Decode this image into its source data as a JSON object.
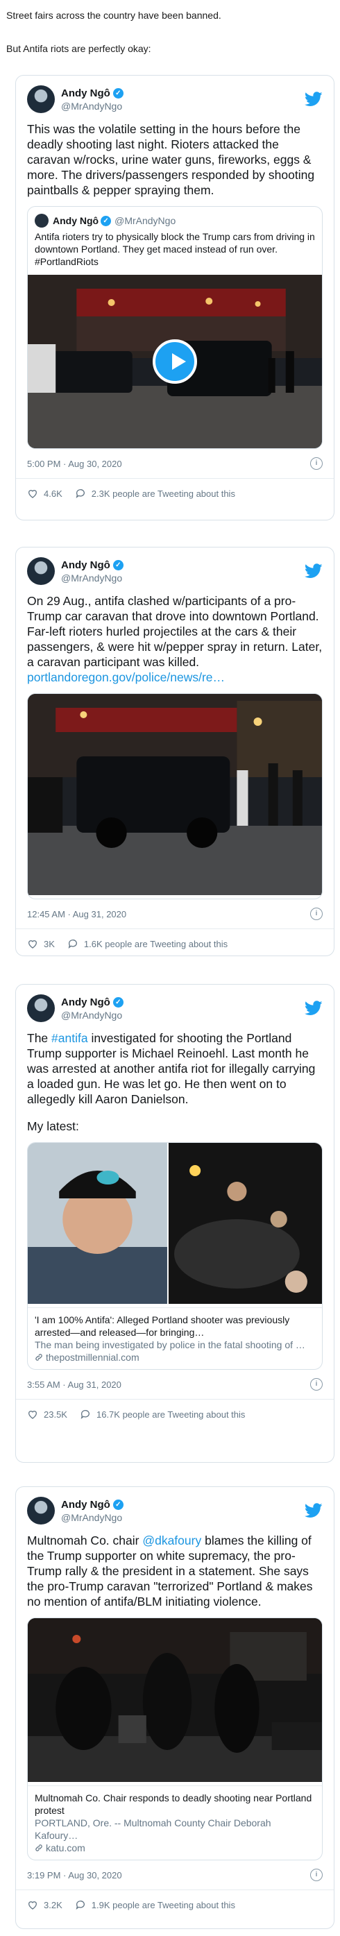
{
  "intro": {
    "line1": "Street fairs across the country have been banned.",
    "line2": "But Antifa riots are perfectly okay:"
  },
  "author": {
    "name": "Andy Ngô",
    "handle": "@MrAndyNgo"
  },
  "colors": {
    "link": "#1b95e0",
    "twitter_blue": "#1da1f2",
    "border": "#d8e1e8",
    "muted": "#657786"
  },
  "tweets": [
    {
      "text": "This was the volatile setting in the hours before the deadly shooting last night. Rioters attacked the caravan w/rocks, urine water guns, fireworks, eggs & more. The drivers/passengers responded by shooting paintballs & pepper spraying them.",
      "quote": {
        "name": "Andy Ngô",
        "handle": "@MrAndyNgo",
        "text": "Antifa rioters try to physically block the Trump cars from driving in downtown Portland. They get maced instead of run over. #PortlandRiots"
      },
      "timestamp": "5:00 PM · Aug 30, 2020",
      "likes": "4.6K",
      "tweeting": "2.3K people are Tweeting about this"
    },
    {
      "text": "On 29 Aug., antifa clashed w/participants of a pro-Trump car caravan that drove into downtown Portland. Far-left rioters hurled projectiles at the cars & their passengers, & were hit w/pepper spray in return. Later, a caravan participant was killed.",
      "link": "portlandoregon.gov/police/news/re…",
      "timestamp": "12:45 AM · Aug 31, 2020",
      "likes": "3K",
      "tweeting": "1.6K people are Tweeting about this"
    },
    {
      "text_pre": "The ",
      "hashtag": "#antifa",
      "text_post": " investigated for shooting the Portland Trump supporter is Michael Reinoehl. Last month he was arrested at another antifa riot for illegally carrying a loaded gun. He was let go. He then went on to allegedly kill Aaron Danielson.",
      "latest": "My latest:",
      "card": {
        "title": "'I am 100% Antifa': Alleged Portland shooter was previously arrested—and released—for bringing…",
        "desc": "The man being investigated by police in the fatal shooting of …",
        "domain": "thepostmillennial.com"
      },
      "timestamp": "3:55 AM · Aug 31, 2020",
      "likes": "23.5K",
      "tweeting": "16.7K people are Tweeting about this"
    },
    {
      "text_pre": "Multnomah Co. chair ",
      "mention": "@dkafoury",
      "text_post": " blames the killing of the Trump supporter on white supremacy, the pro-Trump rally & the president in a statement. She says the pro-Trump caravan \"terrorized\" Portland & makes no mention of antifa/BLM initiating violence.",
      "card": {
        "title": "Multnomah Co. Chair responds to deadly shooting near Portland protest",
        "desc": "PORTLAND, Ore. -- Multnomah County Chair Deborah Kafoury…",
        "domain": "katu.com"
      },
      "timestamp": "3:19 PM · Aug 30, 2020",
      "likes": "3.2K",
      "tweeting": "1.9K people are Tweeting about this"
    }
  ]
}
